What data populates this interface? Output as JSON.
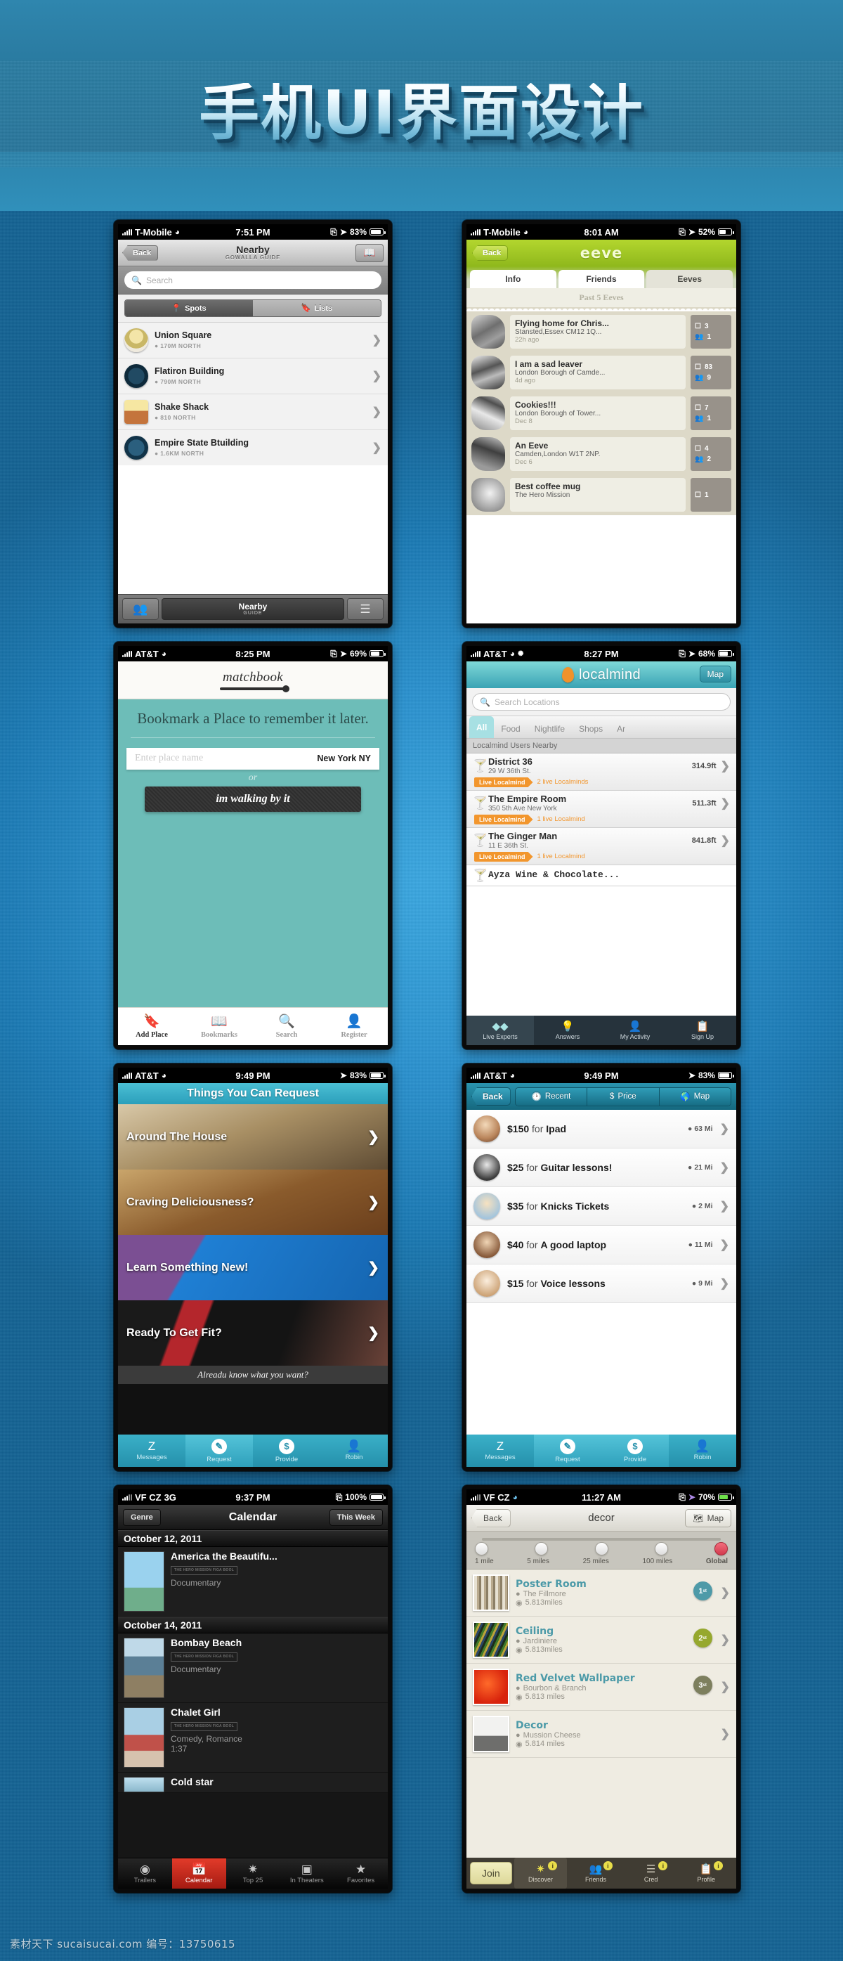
{
  "poster": {
    "title": "手机UI界面设计",
    "watermark": "素材天下 sucaisucai.com  编号：13750615",
    "accent_blue": "#2b92cf",
    "banner_blue": "#2d7fa5"
  },
  "screens": [
    {
      "id": "gowalla",
      "status": {
        "carrier": "T-Mobile",
        "network": "",
        "time": "7:51 PM",
        "battery": "83%"
      },
      "nav": {
        "back": "Back",
        "title": "Nearby",
        "subtitle": "GOWALLA GUIDE",
        "right_icon": "map-icon"
      },
      "search_placeholder": "Search",
      "segments": [
        {
          "label": "Spots",
          "selected": true
        },
        {
          "label": "Lists",
          "selected": false
        }
      ],
      "rows": [
        {
          "name": "Union Square",
          "meta": "170M NORTH"
        },
        {
          "name": "Flatiron Building",
          "meta": "790M NORTH"
        },
        {
          "name": "Shake Shack",
          "meta": "810 NORTH"
        },
        {
          "name": "Empire State Btuilding",
          "meta": "1.6KM NORTH"
        }
      ],
      "tabbar": {
        "left_icon": "friends-icon",
        "center_title": "Nearby",
        "center_sub": "GUIDE",
        "right_icon": "list-icon"
      }
    },
    {
      "id": "eeve",
      "status": {
        "carrier": "T-Mobile",
        "network": "",
        "time": "8:01 AM",
        "battery": "52%"
      },
      "nav": {
        "back": "Back",
        "title": "eeve"
      },
      "tabs": [
        {
          "label": "Info",
          "selected": true
        },
        {
          "label": "Friends",
          "selected": true
        },
        {
          "label": "Eeves",
          "selected": false
        }
      ],
      "section": "Past 5 Eeves",
      "items": [
        {
          "title": "Flying home for Chris...",
          "place": "Stansted,Essex CM12 1Q...",
          "time": "22h ago",
          "photos": "3",
          "people": "1"
        },
        {
          "title": "I am a sad leaver",
          "place": "London Borough of Camde...",
          "time": "4d ago",
          "photos": "83",
          "people": "9"
        },
        {
          "title": "Cookies!!!",
          "place": "London Borough of Tower...",
          "time": "Dec 8",
          "photos": "7",
          "people": "1"
        },
        {
          "title": "An Eeve",
          "place": "Camden,London W1T 2NP.",
          "time": "Dec 6",
          "photos": "4",
          "people": "2"
        },
        {
          "title": "Best coffee mug",
          "place": "The Hero Mission",
          "time": "",
          "photos": "1",
          "people": ""
        }
      ]
    },
    {
      "id": "matchbook",
      "status": {
        "carrier": "AT&T",
        "network": "",
        "time": "8:25 PM",
        "battery": "69%"
      },
      "logo": "matchbook",
      "headline": "Bookmark a Place to remember it later.",
      "field": {
        "placeholder": "Enter place name",
        "value": "New York NY"
      },
      "or_label": "or",
      "button": "im walking by it",
      "tabbar": [
        {
          "label": "Add Place",
          "icon": "bookmark-plus-icon",
          "selected": true
        },
        {
          "label": "Bookmarks",
          "icon": "book-icon",
          "selected": false
        },
        {
          "label": "Search",
          "icon": "search-icon",
          "selected": false
        },
        {
          "label": "Register",
          "icon": "person-icon",
          "selected": false
        }
      ]
    },
    {
      "id": "localmind",
      "status": {
        "carrier": "AT&T",
        "network": "",
        "time": "8:27 PM",
        "battery": "68%"
      },
      "logo": "localmind",
      "map_button": "Map",
      "search_placeholder": "Search Locations",
      "categories": [
        {
          "label": "All",
          "selected": true
        },
        {
          "label": "Food",
          "selected": false
        },
        {
          "label": "Nightlife",
          "selected": false
        },
        {
          "label": "Shops",
          "selected": false
        },
        {
          "label": "Ar",
          "selected": false
        }
      ],
      "section": "Localmind Users Nearby",
      "rows": [
        {
          "name": "District 36",
          "address": "29 W 36th St.",
          "distance": "314.9ft",
          "badge": "Live Localmind",
          "badge_text": "2 live Localminds"
        },
        {
          "name": "The Empire Room",
          "address": "350 5th Ave New York",
          "distance": "511.3ft",
          "badge": "Live Localmind",
          "badge_text": "1 live Localmind"
        },
        {
          "name": "The Ginger Man",
          "address": "11 E 36th St.",
          "distance": "841.8ft",
          "badge": "Live Localmind",
          "badge_text": "1 live Localmind"
        },
        {
          "name": "Ayza Wine & Chocolate...",
          "address": "",
          "distance": "",
          "badge": "",
          "badge_text": ""
        }
      ],
      "tabbar": [
        {
          "label": "Live Experts",
          "icon": "diamonds-icon",
          "selected": true
        },
        {
          "label": "Answers",
          "icon": "bulb-icon",
          "selected": false
        },
        {
          "label": "My Activity",
          "icon": "person-question-icon",
          "selected": false
        },
        {
          "label": "Sign Up",
          "icon": "id-card-icon",
          "selected": false
        }
      ]
    },
    {
      "id": "request",
      "status": {
        "carrier": "AT&T",
        "network": "",
        "time": "9:49 PM",
        "battery": "83%"
      },
      "header": "Things You Can Request",
      "bands": [
        {
          "label": "Around The House"
        },
        {
          "label": "Craving Deliciousness?"
        },
        {
          "label": "Learn Something New!"
        },
        {
          "label": "Ready To Get Fit?"
        }
      ],
      "note": "Alreadu know what you want?",
      "tabbar": [
        {
          "label": "Messages",
          "icon": "zaarly-z-icon",
          "selected": false
        },
        {
          "label": "Request",
          "icon": "pencil-icon",
          "selected": true
        },
        {
          "label": "Provide",
          "icon": "dollar-icon",
          "selected": false
        },
        {
          "label": "Robin",
          "icon": "person-icon",
          "selected": false
        }
      ]
    },
    {
      "id": "price",
      "status": {
        "carrier": "AT&T",
        "network": "",
        "time": "9:49 PM",
        "battery": "83%"
      },
      "nav": {
        "back": "Back",
        "segments": [
          {
            "label": "Recent",
            "icon": "clock-icon"
          },
          {
            "label": "Price",
            "icon": "dollar-icon"
          },
          {
            "label": "Map",
            "icon": "globe-icon"
          }
        ]
      },
      "rows": [
        {
          "price": "$150",
          "for": "for",
          "item": "Ipad",
          "distance": "63 Mi"
        },
        {
          "price": "$25",
          "for": "for",
          "item": "Guitar lessons!",
          "distance": "21 Mi"
        },
        {
          "price": "$35",
          "for": "for",
          "item": "Knicks Tickets",
          "distance": "2 Mi"
        },
        {
          "price": "$40",
          "for": "for",
          "item": "A good laptop",
          "distance": "11 Mi"
        },
        {
          "price": "$15",
          "for": "for",
          "item": "Voice lessons",
          "distance": "9 Mi"
        }
      ],
      "tabbar": [
        {
          "label": "Messages",
          "icon": "zaarly-z-icon",
          "selected": false
        },
        {
          "label": "Request",
          "icon": "pencil-icon",
          "selected": true
        },
        {
          "label": "Provide",
          "icon": "dollar-icon",
          "selected": true
        },
        {
          "label": "Robin",
          "icon": "person-icon",
          "selected": false
        }
      ]
    },
    {
      "id": "calendar",
      "status": {
        "carrier": "VF CZ",
        "network": "3G",
        "time": "9:37 PM",
        "battery": "100%"
      },
      "nav": {
        "left": "Genre",
        "title": "Calendar",
        "right": "This Week"
      },
      "sections": [
        {
          "date": "October 12, 2011",
          "movies": [
            {
              "title": "America the Beautifu...",
              "rating": "THE HERO MISSION FIGA BOOL",
              "genre": "Documentary",
              "runtime": ""
            }
          ]
        },
        {
          "date": "October 14, 2011",
          "movies": [
            {
              "title": "Bombay Beach",
              "rating": "THE HERO MISSION FIGA BOOL",
              "genre": "Documentary",
              "runtime": ""
            },
            {
              "title": "Chalet Girl",
              "rating": "THE HERO MISSION FIGA BOOL",
              "genre": "Comedy, Romance",
              "runtime": "1:37"
            },
            {
              "title": "Cold star",
              "rating": "",
              "genre": "",
              "runtime": ""
            }
          ]
        }
      ],
      "tabbar": [
        {
          "label": "Trailers",
          "icon": "film-reel-icon",
          "selected": false
        },
        {
          "label": "Calendar",
          "icon": "calendar-icon",
          "selected": true
        },
        {
          "label": "Top 25",
          "icon": "burst-25-icon",
          "selected": false
        },
        {
          "label": "In Theaters",
          "icon": "projector-icon",
          "selected": false
        },
        {
          "label": "Favorites",
          "icon": "star-icon",
          "selected": false
        }
      ]
    },
    {
      "id": "decor",
      "status": {
        "carrier": "VF CZ",
        "network": "",
        "time": "11:27 AM",
        "battery": "70%"
      },
      "nav": {
        "back": "Back",
        "title": "decor",
        "map": "Map"
      },
      "slider": {
        "stops": [
          "1 mile",
          "5 miles",
          "25 miles",
          "100 miles",
          "Global"
        ],
        "selected_index": 4
      },
      "rows": [
        {
          "name": "Poster Room",
          "place": "The Fillmore",
          "distance": "5.813miles",
          "rank": "1",
          "rank_suffix": "st",
          "rank_color": "#4e9aa8"
        },
        {
          "name": "Ceiling",
          "place": "Jardiniere",
          "distance": "5.813miles",
          "rank": "2",
          "rank_suffix": "st",
          "rank_color": "#96a82e"
        },
        {
          "name": "Red Velvet Wallpaper",
          "place": "Bourbon & Branch",
          "distance": "5.813 miles",
          "rank": "3",
          "rank_suffix": "st",
          "rank_color": "#7d7f5e"
        },
        {
          "name": "Decor",
          "place": "Mussion Cheese",
          "distance": "5.814 miles",
          "rank": "",
          "rank_suffix": "",
          "rank_color": ""
        }
      ],
      "join_button": "Join",
      "tabbar": [
        {
          "label": "Discover",
          "icon": "ribbon-1st-icon",
          "selected": true,
          "badge": "i"
        },
        {
          "label": "Friends",
          "icon": "people-icon",
          "selected": false,
          "badge": "i"
        },
        {
          "label": "Cred",
          "icon": "bars-icon",
          "selected": false,
          "badge": "i"
        },
        {
          "label": "Profile",
          "icon": "id-card-icon",
          "selected": false,
          "badge": "i"
        }
      ]
    }
  ]
}
